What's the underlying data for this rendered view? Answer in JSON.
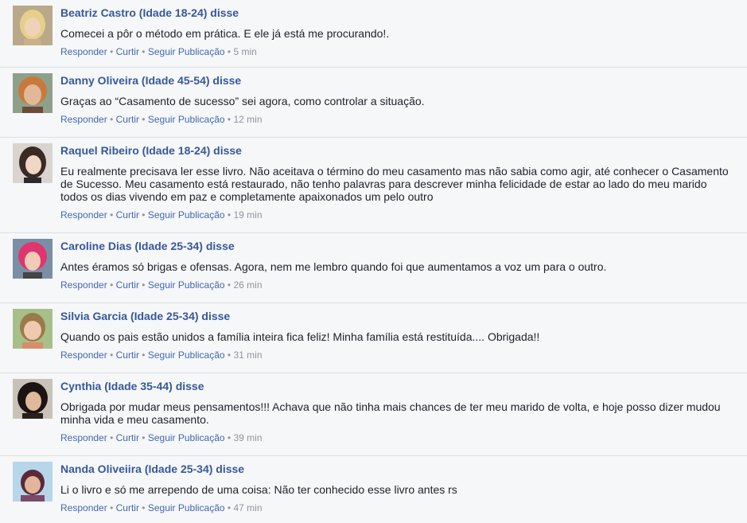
{
  "actions": {
    "reply": "Responder",
    "like": "Curtir",
    "follow": "Seguir Publicação",
    "separator": "•"
  },
  "comments": [
    {
      "author": "Beatriz Castro (Idade 18-24) disse",
      "text": "Comecei a pôr o método em prática. E ele já está me procurando!.",
      "time": "5 min"
    },
    {
      "author": "Danny Oliveira (Idade 45-54) disse",
      "text": "Graças ao “Casamento de sucesso” sei agora, como controlar a situação.",
      "time": "12 min"
    },
    {
      "author": "Raquel Ribeiro (Idade 18-24) disse",
      "text": "Eu realmente precisava ler esse livro. Não aceitava o término do meu casamento mas não sabia como agir, até conhecer o Casamento de Sucesso. Meu casamento está restaurado, não tenho palavras para descrever minha felicidade de estar ao lado do meu marido todos os dias vivendo em paz e completamente apaixonados um pelo outro",
      "time": "19 min"
    },
    {
      "author": "Caroline Dias (Idade 25-34) disse",
      "text": "Antes éramos só brigas e ofensas. Agora, nem me lembro quando foi que aumentamos a voz um para o outro.",
      "time": "26 min"
    },
    {
      "author": "Silvia Garcia (Idade 25-34) disse",
      "text": "Quando os pais estão unidos a família inteira fica feliz! Minha família está restituída.... Obrigada!!",
      "time": "31 min"
    },
    {
      "author": "Cynthia (Idade 35-44) disse",
      "text": "Obrigada por mudar meus pensamentos!!! Achava que não tinha mais chances de ter meu marido de volta, e hoje posso dizer mudou minha vida e meu casamento.",
      "time": "39 min"
    },
    {
      "author": "Nanda Oliveiira (Idade 25-34) disse",
      "text": "Li o livro e só me arrependo de uma coisa: Não ter conhecido esse livro antes rs",
      "time": "47 min"
    }
  ],
  "colors": {
    "author": "#365899",
    "link": "#4267b2",
    "meta": "#90949c",
    "text": "#1d2129",
    "background": "#f6f7f9",
    "divider": "#dddfe2"
  }
}
